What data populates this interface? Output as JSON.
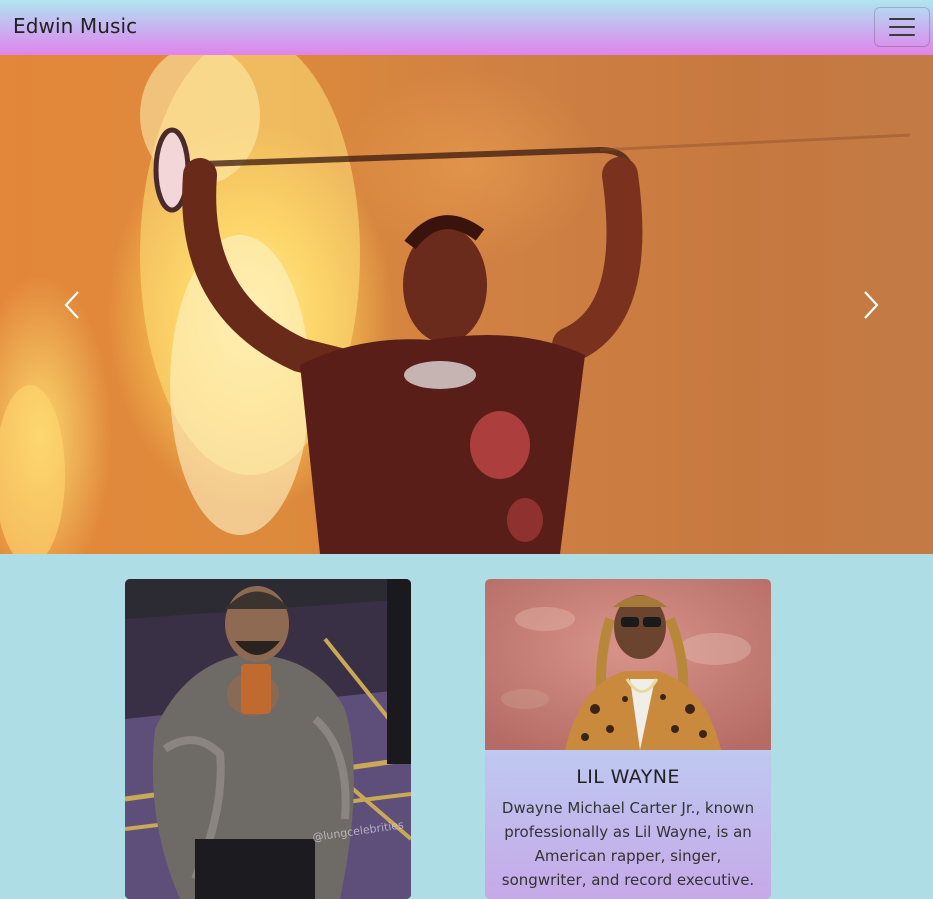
{
  "navbar": {
    "brand": "Edwin Music",
    "toggler_icon": "hamburger-icon"
  },
  "carousel": {
    "prev_icon": "chevron-left-icon",
    "next_icon": "chevron-right-icon"
  },
  "cards": [
    {
      "title": "",
      "text": ""
    },
    {
      "title": "LIL WAYNE",
      "text": "Dwayne Michael Carter Jr., known professionally as Lil Wayne, is an American rapper, singer, songwriter, and record executive."
    }
  ],
  "colors": {
    "page_background": "#afdde5",
    "navbar_gradient_top": "#b0e6f0",
    "navbar_gradient_bottom": "#e084ea",
    "card_gradient_top": "#b6ecf6",
    "card_gradient_bottom": "#c6a9e8"
  }
}
